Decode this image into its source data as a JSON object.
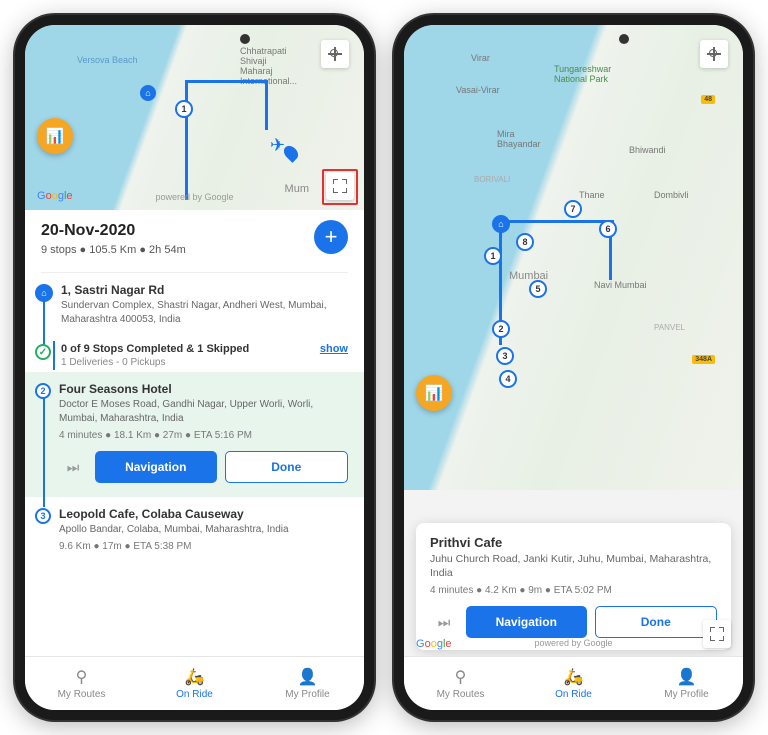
{
  "phone1": {
    "map": {
      "labels": {
        "versova": "Versova Beach",
        "airport": "Chhatrapati\nShivaji\nMaharaj\nInternational...",
        "mumbai": "Mum"
      },
      "google": "Google",
      "powered": "powered by Google"
    },
    "header": {
      "date": "20-Nov-2020",
      "summary": "9 stops ● 105.5 Km ● 2h 54m"
    },
    "stops": {
      "start": {
        "title": "1, Sastri Nagar Rd",
        "addr": "Sundervan Complex, Shastri Nagar, Andheri West, Mumbai, Maharashtra 400053, India"
      },
      "progress": {
        "text": "0 of 9 Stops Completed & 1 Skipped",
        "sub": "1 Deliveries - 0 Pickups",
        "show": "show"
      },
      "stop2": {
        "num": "2",
        "title": "Four Seasons Hotel",
        "addr": "Doctor E Moses Road, Gandhi Nagar, Upper Worli, Worli, Mumbai, Maharashtra, India",
        "meta": "4 minutes ● 18.1 Km ● 27m ● ETA 5:16 PM"
      },
      "stop3": {
        "num": "3",
        "title": "Leopold Cafe, Colaba Causeway",
        "addr": "Apollo Bandar, Colaba, Mumbai, Maharashtra, India",
        "meta": "9.6 Km ● 17m ● ETA 5:38 PM"
      }
    },
    "actions": {
      "nav": "Navigation",
      "done": "Done"
    },
    "bottomNav": {
      "routes": "My Routes",
      "onride": "On Ride",
      "profile": "My Profile"
    }
  },
  "phone2": {
    "map": {
      "labels": {
        "virar": "Virar",
        "vasai": "Vasai-Virar",
        "tung": "Tungareshwar\nNational Park",
        "mira": "Mira\nBhayandar",
        "bhiwandi": "Bhiwandi",
        "borivali": "BORIVALI",
        "thane": "Thane",
        "dombivli": "Dombivli",
        "mumbai": "Mumbai",
        "navi": "Navi Mumbai",
        "panvel": "PANVEL"
      },
      "roads": {
        "r48": "48",
        "r348a": "348A"
      },
      "google": "Google",
      "powered": "powered by Google"
    },
    "card": {
      "title": "Prithvi Cafe",
      "addr": "Juhu Church Road, Janki Kutir, Juhu, Mumbai, Maharashtra, India",
      "meta": "4 minutes ● 4.2 Km ● 9m ● ETA 5:02 PM"
    },
    "actions": {
      "nav": "Navigation",
      "done": "Done"
    },
    "bottomNav": {
      "routes": "My Routes",
      "onride": "On Ride",
      "profile": "My Profile"
    }
  }
}
